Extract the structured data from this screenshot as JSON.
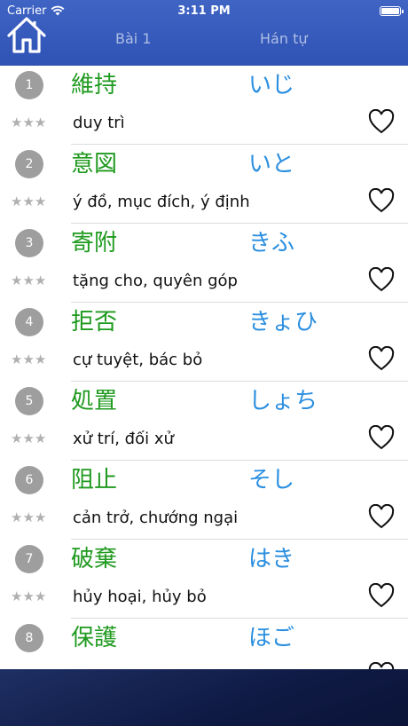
{
  "status_bar": {
    "carrier": "Carrier",
    "time": "3:11 PM"
  },
  "header": {
    "tabs": [
      {
        "label": "Bài 1"
      },
      {
        "label": "Hán tự"
      }
    ]
  },
  "colors": {
    "header": "#3359bd",
    "kanji": "#1f9a1f",
    "kana": "#2b8fe0",
    "footer": "#101a45"
  },
  "stars_text": "★★★",
  "words": [
    {
      "num": "1",
      "kanji": "維持",
      "kana": "いじ",
      "meaning": "duy trì"
    },
    {
      "num": "2",
      "kanji": "意図",
      "kana": "いと",
      "meaning": "ý đồ, mục đích, ý định"
    },
    {
      "num": "3",
      "kanji": "寄附",
      "kana": "きふ",
      "meaning": "tặng cho, quyên góp"
    },
    {
      "num": "4",
      "kanji": "拒否",
      "kana": "きょひ",
      "meaning": "cự tuyệt, bác bỏ"
    },
    {
      "num": "5",
      "kanji": "処置",
      "kana": "しょち",
      "meaning": "xử trí, đối xử"
    },
    {
      "num": "6",
      "kanji": "阻止",
      "kana": "そし",
      "meaning": "cản trở, chướng ngại"
    },
    {
      "num": "7",
      "kanji": "破棄",
      "kana": "はき",
      "meaning": "hủy hoại, hủy bỏ"
    },
    {
      "num": "8",
      "kanji": "保護",
      "kana": "ほご",
      "meaning": ""
    }
  ]
}
